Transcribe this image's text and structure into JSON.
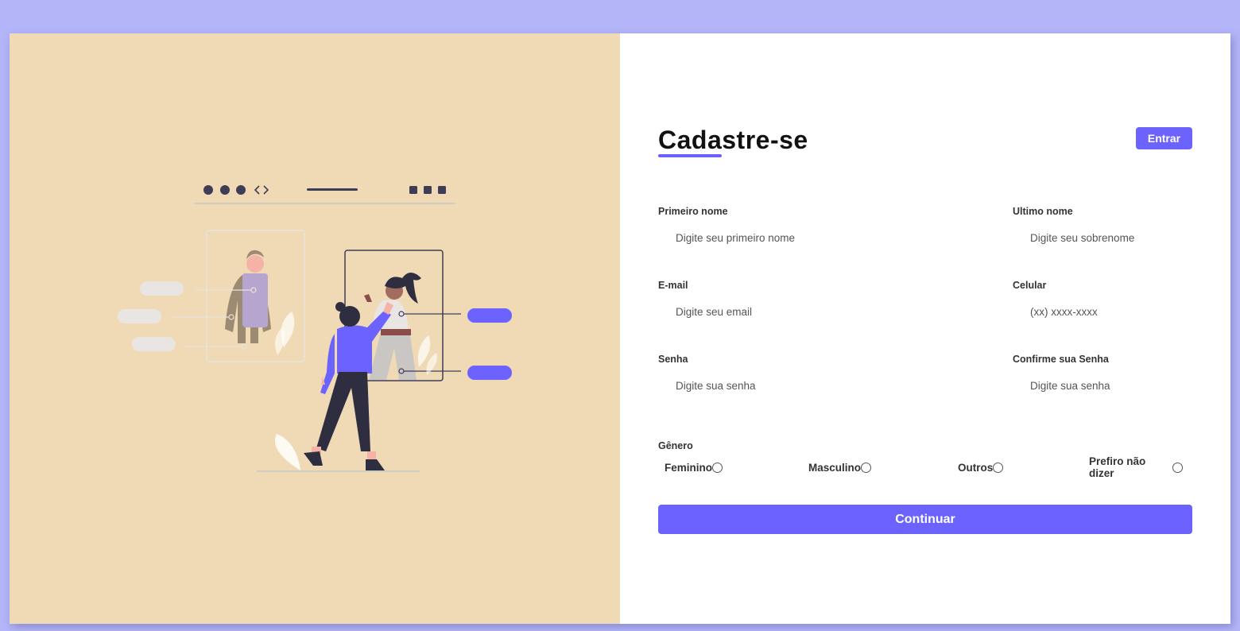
{
  "header": {
    "title": "Cadastre-se",
    "login_label": "Entrar"
  },
  "fields": {
    "first_name": {
      "label": "Primeiro nome",
      "placeholder": "Digite seu primeiro nome",
      "value": ""
    },
    "last_name": {
      "label": "Ultimo nome",
      "placeholder": "Digite seu sobrenome",
      "value": ""
    },
    "email": {
      "label": "E-mail",
      "placeholder": "Digite seu email",
      "value": ""
    },
    "phone": {
      "label": "Celular",
      "placeholder": "(xx) xxxx-xxxx",
      "value": ""
    },
    "password": {
      "label": "Senha",
      "placeholder": "Digite sua senha",
      "value": ""
    },
    "confirm_password": {
      "label": "Confirme sua Senha",
      "placeholder": "Digite sua senha",
      "value": ""
    }
  },
  "gender": {
    "title": "Gênero",
    "options": [
      "Feminino",
      "Masculino",
      "Outros",
      "Prefiro não dizer"
    ],
    "selected": null
  },
  "submit_label": "Continuar",
  "colors": {
    "accent": "#6c63ff",
    "page_background": "#b4b5f8",
    "illustration_background": "#f0dab6",
    "form_background": "#ffffff"
  },
  "illustration": {
    "icon": "fashion-tryon-illustration"
  }
}
